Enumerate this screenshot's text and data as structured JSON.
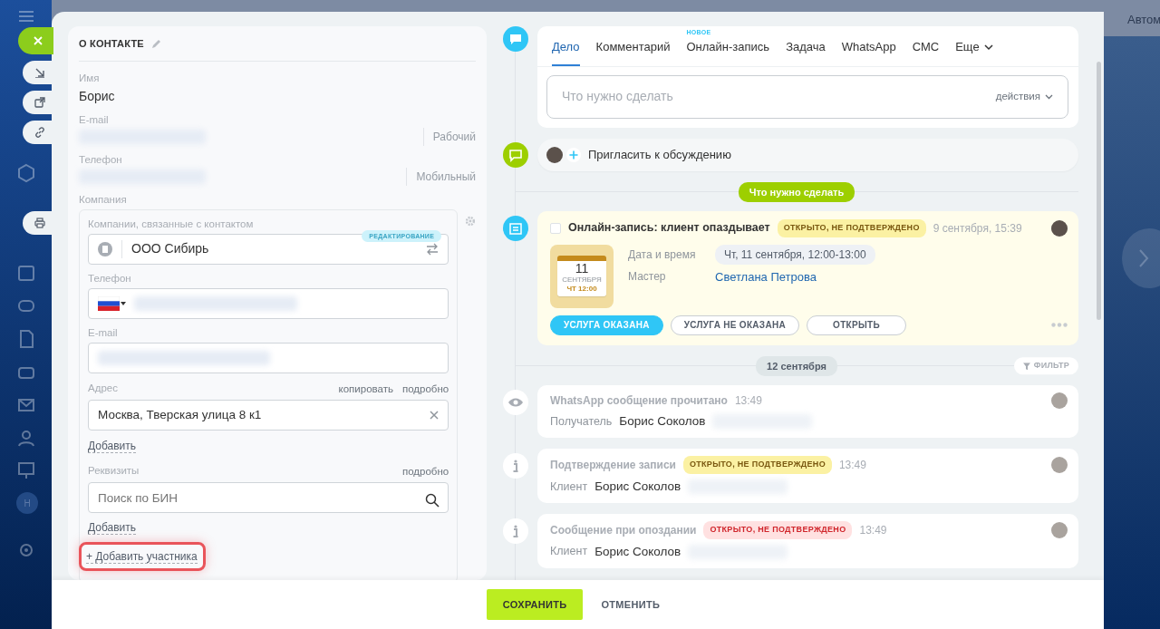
{
  "page_header": {
    "text": "Автом"
  },
  "sidebar": {
    "avatar_letter": "Н"
  },
  "contact": {
    "title": "О КОНТАКТЕ",
    "name_label": "Имя",
    "name": "Борис",
    "fields": [
      {
        "label": "E-mail",
        "type": "Рабочий"
      },
      {
        "label": "Телефон",
        "type": "Мобильный"
      }
    ],
    "company": {
      "label": "Компания",
      "related_label": "Компании, связанные с контактом",
      "name": "ООО Сибирь",
      "mode_badge": "РЕДАКТИРОВАНИЕ",
      "phone_label": "Телефон",
      "email_label": "E-mail",
      "address_label": "Адрес",
      "address_actions": [
        "копировать",
        "подробно"
      ],
      "address": "Москва, Тверская улица 8 к1",
      "add_address": "Добавить",
      "requisites_label": "Реквизиты",
      "requisites_actions": [
        "подробно"
      ],
      "requisites_placeholder": "Поиск по БИН",
      "add_requisites": "Добавить"
    },
    "add_participant": {
      "text": "+ Добавить участника",
      "highlighted": true
    }
  },
  "timeline": {
    "composer": {
      "tabs": [
        {
          "label": "Дело",
          "selected": true
        },
        {
          "label": "Комментарий",
          "selected": false
        },
        {
          "label": "Онлайн-запись",
          "selected": false,
          "badge": "НОВОЕ"
        },
        {
          "label": "Задача",
          "selected": false
        },
        {
          "label": "WhatsApp",
          "selected": false
        },
        {
          "label": "СМС",
          "selected": false
        },
        {
          "label": "Еще",
          "selected": false,
          "dropdown": true
        }
      ],
      "placeholder": "Что нужно сделать",
      "actions": "действия"
    },
    "invite": {
      "text": "Пригласить к обсуждению"
    },
    "todo_divider": "Что нужно сделать",
    "activity": {
      "checked": false,
      "title": "Онлайн-запись: клиент опаздывает",
      "badge": {
        "text": "ОТКРЫТО, НЕ ПОДТВЕРЖДЕНО",
        "kind": "warning"
      },
      "time": "9 сентября, 15:39",
      "calendar": {
        "day": "11",
        "month": "СЕНТЯБРЯ",
        "time": "ЧТ 12:00"
      },
      "details": [
        {
          "label": "Дата и время",
          "value": "Чт, 11 сентября, 12:00-13:00",
          "kind": "chip"
        },
        {
          "label": "Мастер",
          "value": "Светлана Петрова",
          "kind": "link"
        }
      ],
      "buttons": [
        {
          "label": "УСЛУГА ОКАЗАНА",
          "kind": "primary"
        },
        {
          "label": "УСЛУГА НЕ ОКАЗАНА",
          "kind": "outline"
        },
        {
          "label": "ОТКРЫТЬ",
          "kind": "outline"
        }
      ]
    },
    "date_divider": "12 сентября",
    "filter": "ФИЛЬТР",
    "history": [
      {
        "kind": "read",
        "title": "WhatsApp сообщение прочитано",
        "time": "13:49",
        "field_label": "Получатель",
        "person": "Борис Соколов"
      },
      {
        "kind": "info",
        "title": "Подтверждение записи",
        "badge": {
          "text": "ОТКРЫТО, НЕ ПОДТВЕРЖДЕНО",
          "kind": "warning"
        },
        "time": "13:49",
        "field_label": "Клиент",
        "person": "Борис Соколов"
      },
      {
        "kind": "info",
        "title": "Сообщение при опоздании",
        "badge": {
          "text": "ОТКРЫТО, НЕ ПОДТВЕРЖДЕНО",
          "kind": "danger"
        },
        "time": "13:49",
        "field_label": "Клиент",
        "person": "Борис Соколов"
      }
    ]
  },
  "footer": {
    "buttons": [
      {
        "label": "СОХРАНИТЬ",
        "kind": "primary"
      },
      {
        "label": "ОТМЕНИТЬ",
        "kind": "link"
      }
    ]
  }
}
